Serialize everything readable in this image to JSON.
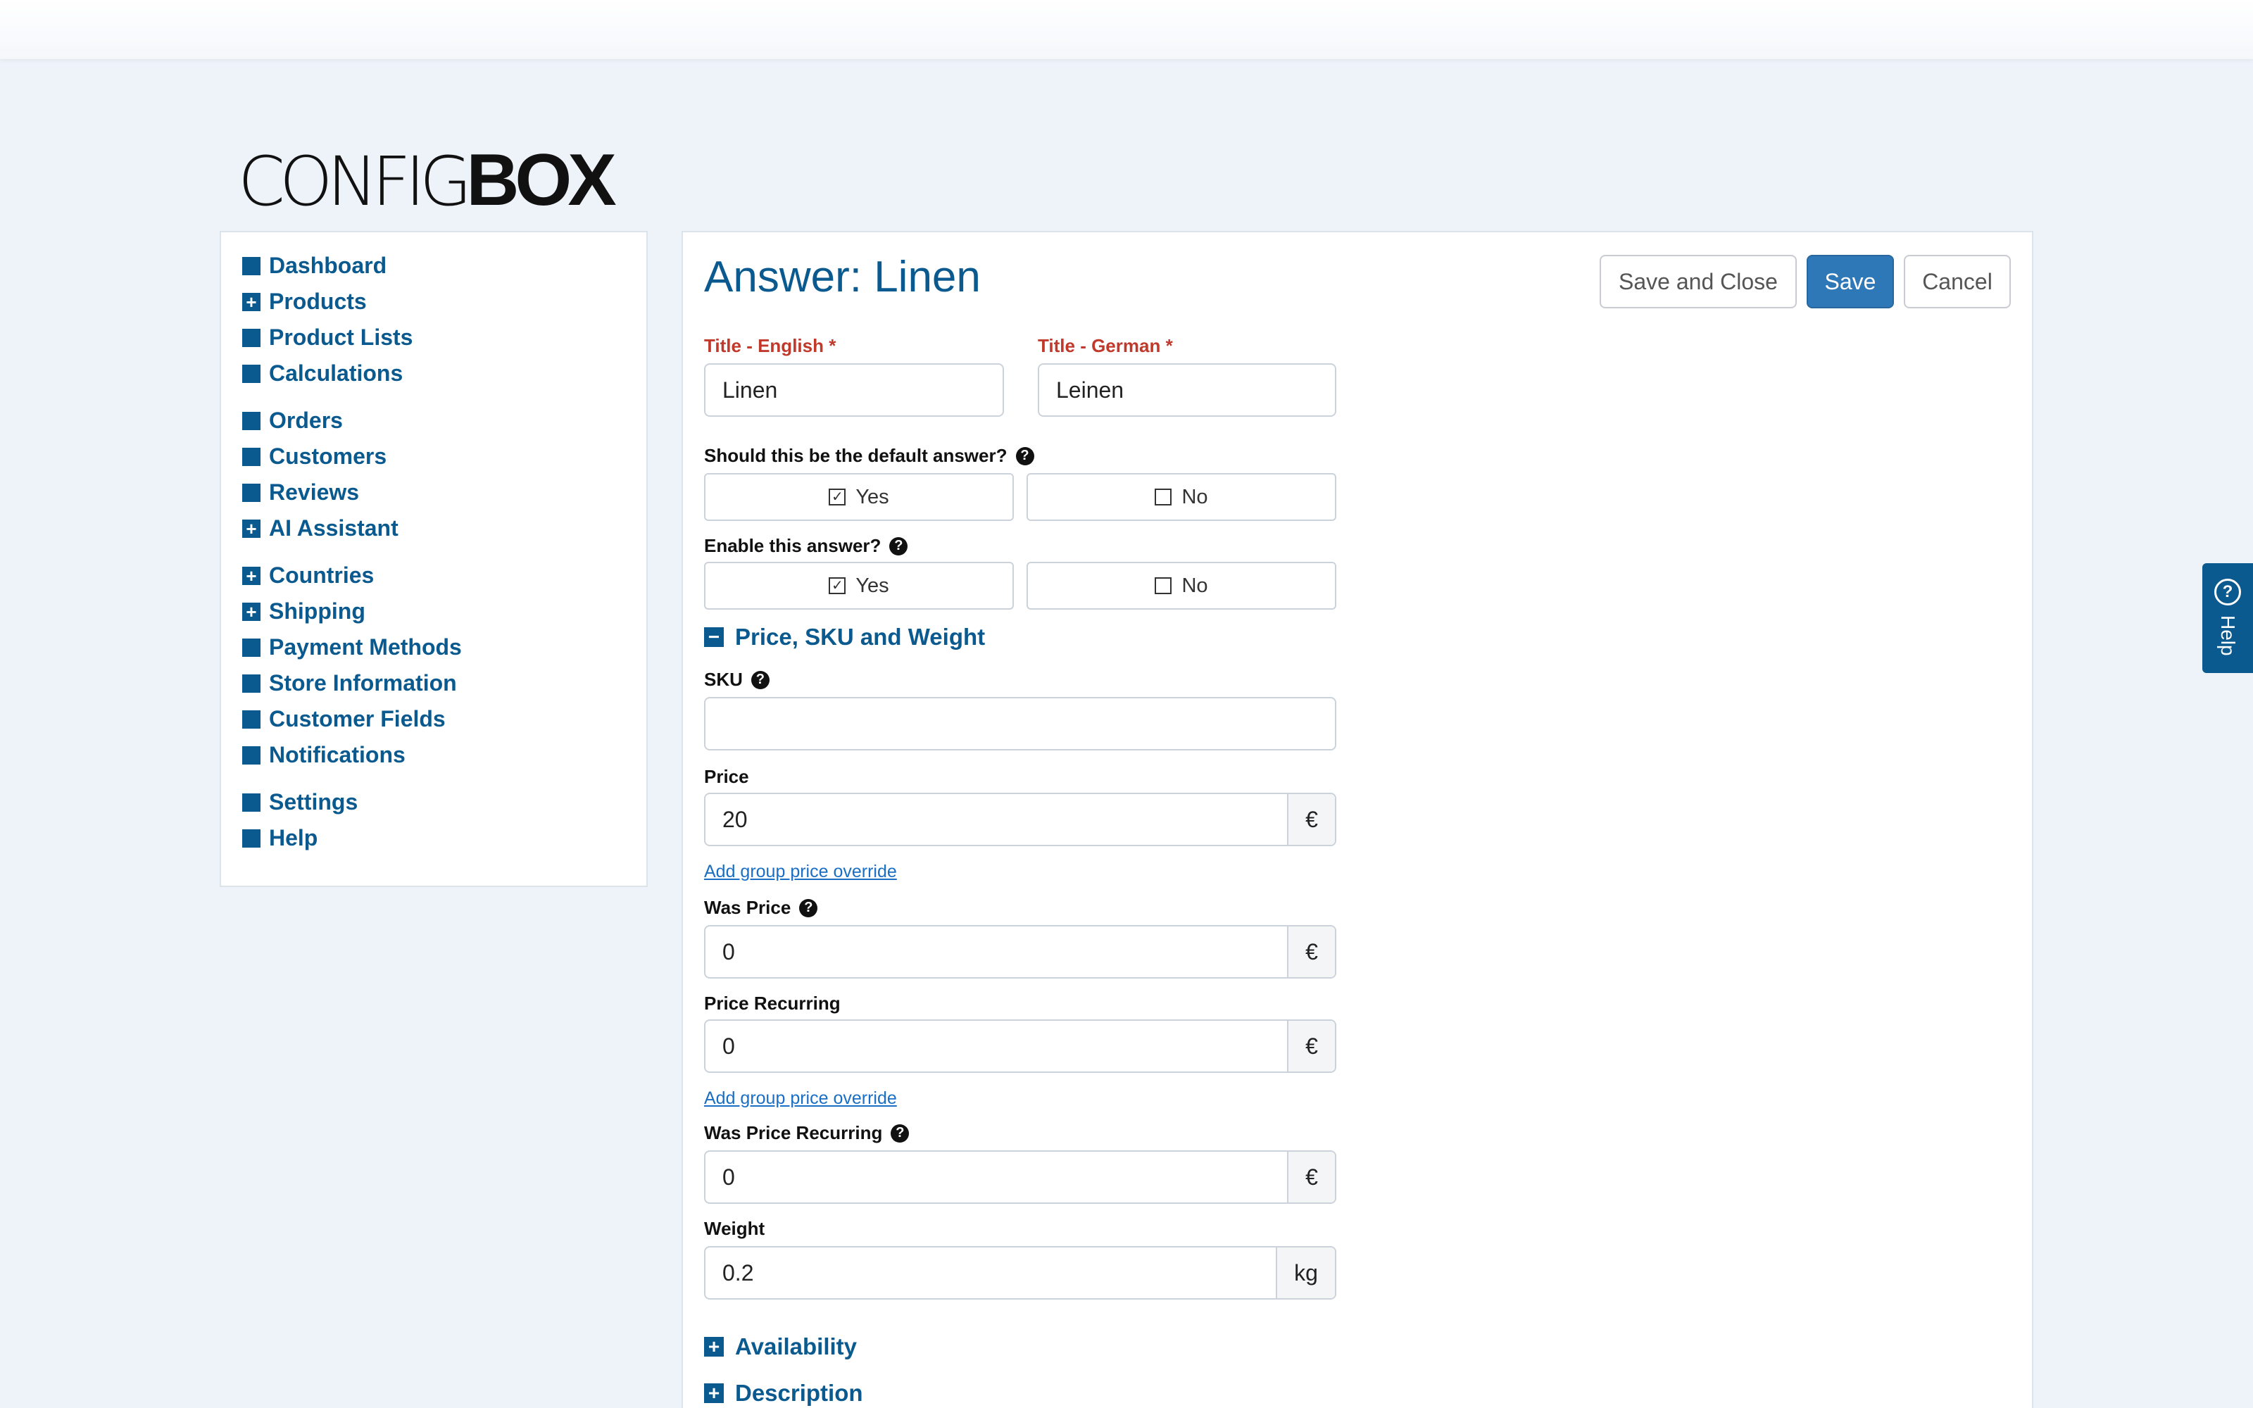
{
  "logo": {
    "light": "CONFIG",
    "bold": "BOX"
  },
  "sidebar": {
    "groups": [
      [
        {
          "label": "Dashboard",
          "icon": "square-icon",
          "glyph": ""
        },
        {
          "label": "Products",
          "icon": "plus-box-icon",
          "glyph": "+"
        },
        {
          "label": "Product Lists",
          "icon": "square-icon",
          "glyph": ""
        },
        {
          "label": "Calculations",
          "icon": "square-icon",
          "glyph": ""
        }
      ],
      [
        {
          "label": "Orders",
          "icon": "square-icon",
          "glyph": ""
        },
        {
          "label": "Customers",
          "icon": "square-icon",
          "glyph": ""
        },
        {
          "label": "Reviews",
          "icon": "square-icon",
          "glyph": ""
        },
        {
          "label": "AI Assistant",
          "icon": "plus-box-icon",
          "glyph": "+"
        }
      ],
      [
        {
          "label": "Countries",
          "icon": "plus-box-icon",
          "glyph": "+"
        },
        {
          "label": "Shipping",
          "icon": "plus-box-icon",
          "glyph": "+"
        },
        {
          "label": "Payment Methods",
          "icon": "square-icon",
          "glyph": ""
        },
        {
          "label": "Store Information",
          "icon": "square-icon",
          "glyph": ""
        },
        {
          "label": "Customer Fields",
          "icon": "square-icon",
          "glyph": ""
        },
        {
          "label": "Notifications",
          "icon": "square-icon",
          "glyph": ""
        }
      ],
      [
        {
          "label": "Settings",
          "icon": "square-icon",
          "glyph": ""
        },
        {
          "label": "Help",
          "icon": "square-icon",
          "glyph": ""
        }
      ]
    ]
  },
  "main": {
    "title": "Answer: Linen",
    "buttons": {
      "save_close": "Save and Close",
      "save": "Save",
      "cancel": "Cancel"
    },
    "title_en": {
      "label": "Title - English *",
      "value": "Linen"
    },
    "title_de": {
      "label": "Title - German *",
      "value": "Leinen"
    },
    "default_answer": {
      "label": "Should this be the default answer?",
      "yes": "Yes",
      "no": "No",
      "selected": "yes"
    },
    "enable_answer": {
      "label": "Enable this answer?",
      "yes": "Yes",
      "no": "No",
      "selected": "yes"
    },
    "section_price": "Price, SKU and Weight",
    "sku": {
      "label": "SKU",
      "value": ""
    },
    "price": {
      "label": "Price",
      "value": "20",
      "unit": "€"
    },
    "add_group_price": "Add group price override",
    "was_price": {
      "label": "Was Price",
      "value": "0",
      "unit": "€"
    },
    "price_recurring": {
      "label": "Price Recurring",
      "value": "0",
      "unit": "€"
    },
    "add_group_price_recurring": "Add group price override",
    "was_price_recurring": {
      "label": "Was Price Recurring",
      "value": "0",
      "unit": "€"
    },
    "weight": {
      "label": "Weight",
      "value": "0.2",
      "unit": "kg"
    },
    "section_availability": "Availability",
    "section_description": "Description"
  },
  "help_tab": {
    "label": "Help"
  },
  "colors": {
    "accent": "#0b5a8f",
    "primary_button": "#2f78b8",
    "required": "#c0392b",
    "link": "#1a6fc4"
  }
}
